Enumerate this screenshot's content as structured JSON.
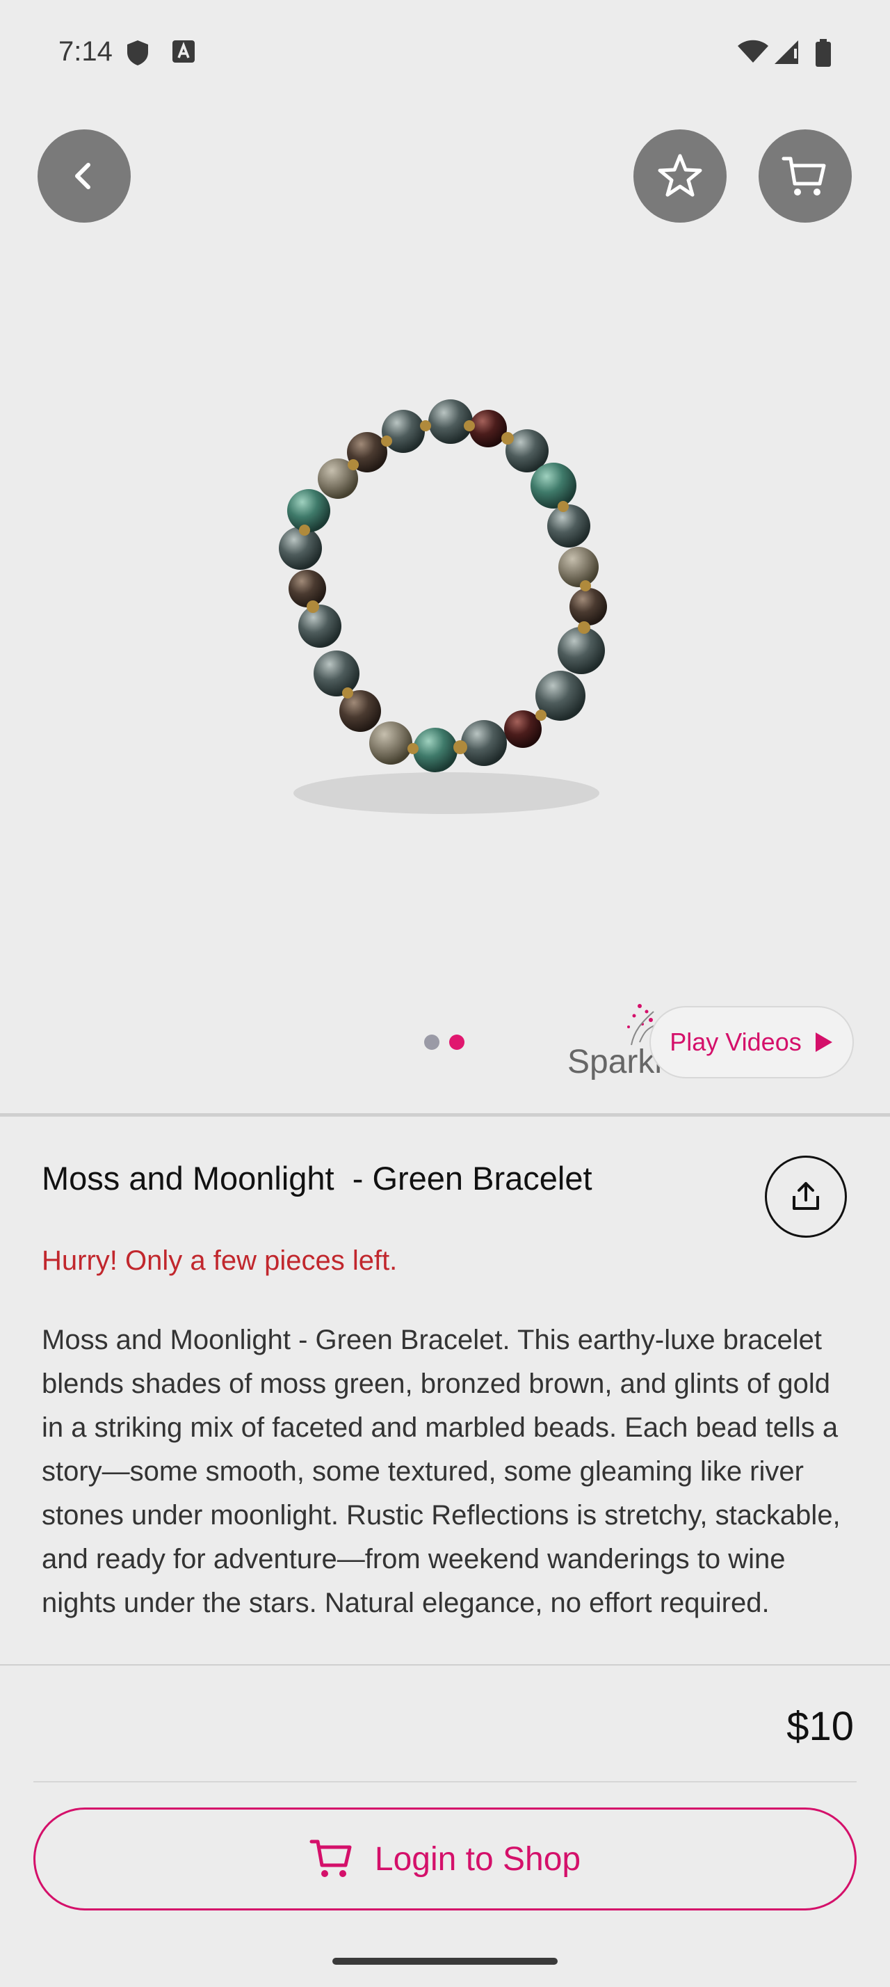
{
  "status_bar": {
    "time": "7:14",
    "icons": [
      "shield-icon",
      "a-icon",
      "wifi-icon",
      "signal-icon",
      "battery-icon"
    ]
  },
  "nav": {
    "back_icon": "chevron-left-icon",
    "favorite_icon": "star-icon",
    "cart_icon": "cart-icon"
  },
  "gallery": {
    "pages": 2,
    "active_page": 2,
    "play_videos_label": "Play Videos"
  },
  "product": {
    "title": "Moss and Moonlight  - Green Bracelet",
    "stock_alert": "Hurry! Only a few pieces left.",
    "description": "Moss and Moonlight  - Green Bracelet. This earthy-luxe bracelet blends shades of moss green, bronzed brown, and glints of gold in a striking mix of faceted and marbled beads. Each bead tells a story—some smooth, some textured, some gleaming like river stones under moonlight. Rustic Reflections is stretchy, stackable, and ready for adventure—from weekend wanderings to wine nights under the stars. Natural elegance, no effort required.",
    "price": "$10"
  },
  "actions": {
    "login_label": "Login to Shop"
  },
  "colors": {
    "accent": "#d4106a",
    "alert": "#c1272d",
    "button_gray": "#7a7a7a"
  }
}
